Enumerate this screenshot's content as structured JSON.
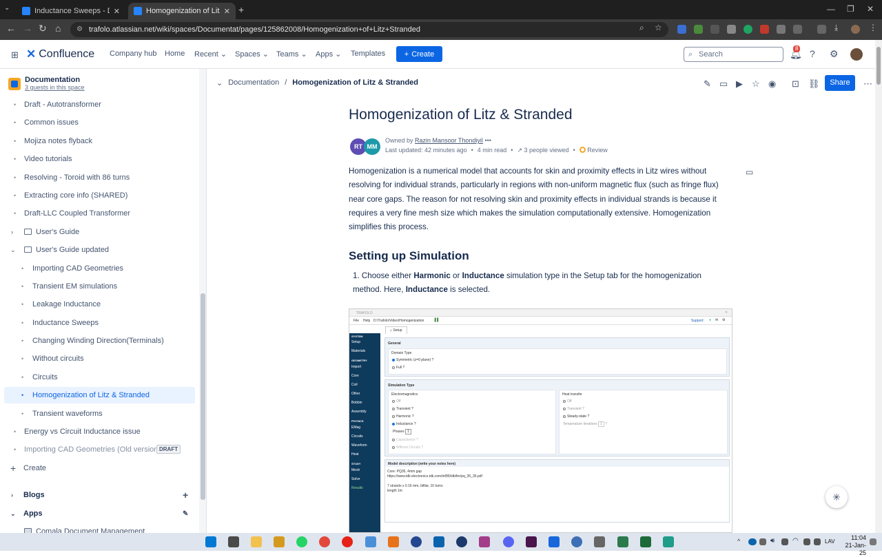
{
  "browser": {
    "tabs": [
      {
        "label": "Inductance Sweeps - Documer",
        "active": false
      },
      {
        "label": "Homogenization of Litz & Stran",
        "active": true
      }
    ],
    "url": "trafolo.atlassian.net/wiki/spaces/Documentat/pages/125862008/Homogenization+of+Litz+Stranded"
  },
  "header": {
    "product": "Confluence",
    "nav": [
      "Company hub",
      "Home",
      "Recent",
      "Spaces",
      "Teams",
      "Apps",
      "Templates"
    ],
    "create_label": "Create",
    "search_placeholder": "Search",
    "notification_count": "8"
  },
  "sidebar": {
    "space_name": "Documentation",
    "guests": "3 guests in this space",
    "items": [
      {
        "label": "Draft - Autotransformer"
      },
      {
        "label": "Common issues"
      },
      {
        "label": "Mojiza notes flyback"
      },
      {
        "label": "Video tutorials"
      },
      {
        "label": "Resolving - Toroid with 86 turns"
      },
      {
        "label": "Extracting core info (SHARED)"
      },
      {
        "label": "Draft-LLC Coupled Transformer"
      },
      {
        "label": "User's Guide"
      },
      {
        "label": "User's Guide updated"
      },
      {
        "label": "Importing CAD Geometries"
      },
      {
        "label": "Transient EM simulations"
      },
      {
        "label": "Leakage Inductance"
      },
      {
        "label": "Inductance Sweeps"
      },
      {
        "label": "Changing Winding Direction(Terminals)"
      },
      {
        "label": "Without circuits"
      },
      {
        "label": "Circuits"
      },
      {
        "label": "Homogenization of Litz & Stranded"
      },
      {
        "label": "Transient waveforms"
      },
      {
        "label": "Energy vs Circuit Inductance issue"
      },
      {
        "label": "Importing CAD Geometries (Old version)",
        "badge": "DRAFT"
      }
    ],
    "create_label": "Create",
    "blogs_label": "Blogs",
    "apps_label": "Apps",
    "apps_item": "Comala Document Management"
  },
  "page": {
    "breadcrumb_space": "Documentation",
    "breadcrumb_current": "Homogenization of Litz & Stranded",
    "share_label": "Share",
    "title": "Homogenization of Litz & Stranded",
    "avatars": [
      {
        "initials": "RT",
        "color": "#5e4db2"
      },
      {
        "initials": "MM",
        "color": "#1d9aaa"
      }
    ],
    "owned_by_label": "Owned by",
    "owner": "Razin Mansoor Thondiyil",
    "last_updated": "Last updated: 42 minutes ago",
    "read_time": "4 min read",
    "viewed": "3 people viewed",
    "review": "Review",
    "intro": "Homogenization is a numerical model that accounts for skin and proximity effects in Litz wires without resolving for individual strands, particularly in regions with non-uniform magnetic flux (such as fringe flux) near core gaps. The reason for not resolving skin and proximity effects in individual strands is because it requires a very fine mesh size which makes the simulation computationally extensive. Homogenization simplifies this process.",
    "section_heading": "Setting up Simulation",
    "step1": {
      "num": "1.",
      "p1": "Choose either ",
      "b1": "Harmonic",
      "p2": " or ",
      "b2": "Inductance",
      "p3": " simulation type in the Setup tab for the homogenization method. Here, ",
      "b3": "Inductance",
      "p4": " is selected."
    }
  },
  "embedded": {
    "app": "TRAFOLO",
    "menu": [
      "File",
      "Help"
    ],
    "path": "D:\\Trafolo\\Video\\Homogenization",
    "support": "Support:",
    "tab": "Setup",
    "sidebar_groups": [
      {
        "heading": "SYSTEM",
        "items": [
          "Setup",
          "Materials"
        ]
      },
      {
        "heading": "GEOMETRY",
        "items": [
          "Import",
          "Core",
          "Coil",
          "Other",
          "Bobbin",
          "Assembly"
        ]
      },
      {
        "heading": "PHYSICS",
        "items": [
          "EMag",
          "Circuits",
          "Waveform",
          "Heat"
        ]
      },
      {
        "heading": "STUDY",
        "items": [
          "Mesh",
          "Solve",
          "Results"
        ]
      }
    ],
    "general": "General",
    "domain_type": "Domain Type",
    "domain_options": [
      "Symmetric (z=0 plane)",
      "Full"
    ],
    "sim_type": "Simulation Type",
    "em_label": "Electromagnetics",
    "em_options": [
      "Off",
      "Transient",
      "Harmonic",
      "Inductance"
    ],
    "phases_label": "Phases",
    "phases_value": "1",
    "em_extra": [
      "Capacitance",
      "Without Circuits"
    ],
    "heat_label": "Heat transfer",
    "heat_options": [
      "Off",
      "Transient",
      "Steady-state"
    ],
    "temp_iter": "Temperature iterations",
    "temp_iter_value": "1",
    "notes_heading": "Model description (write your notes here)",
    "notes": [
      "Core: PQ35, 4mm gap",
      "https://www.tdk-electronics.tdk.com/inf/80/db/fer/pq_35_35.pdf",
      "",
      "7 strands x 0.16 mm, bifilar, 10 turns",
      "length 1m"
    ]
  },
  "taskbar": {
    "lang": "LAV",
    "time": "11:04",
    "date": "21-Jan-25"
  }
}
